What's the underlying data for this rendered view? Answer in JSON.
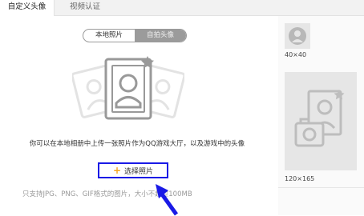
{
  "tabs": [
    {
      "label": "自定义头像",
      "active": true
    },
    {
      "label": "视频认证",
      "active": false
    }
  ],
  "toggle": {
    "local_label": "本地照片",
    "selfie_label": "自拍头像",
    "selected": "自拍头像"
  },
  "description": "你可以在本地相册中上传一张照片作为QQ游戏大厅，以及游戏中的头像",
  "choose_button": {
    "label": "选择照片",
    "icon": "plus-icon"
  },
  "hint": "只支持JPG、PNG、GIF格式的图片，大小不超过100MB",
  "preview": {
    "small_label": "40×40",
    "large_label": "120×165"
  },
  "colors": {
    "highlight": "#1a1ae6",
    "accent": "#f5a623",
    "toggle_active": "#9b9b9b"
  }
}
